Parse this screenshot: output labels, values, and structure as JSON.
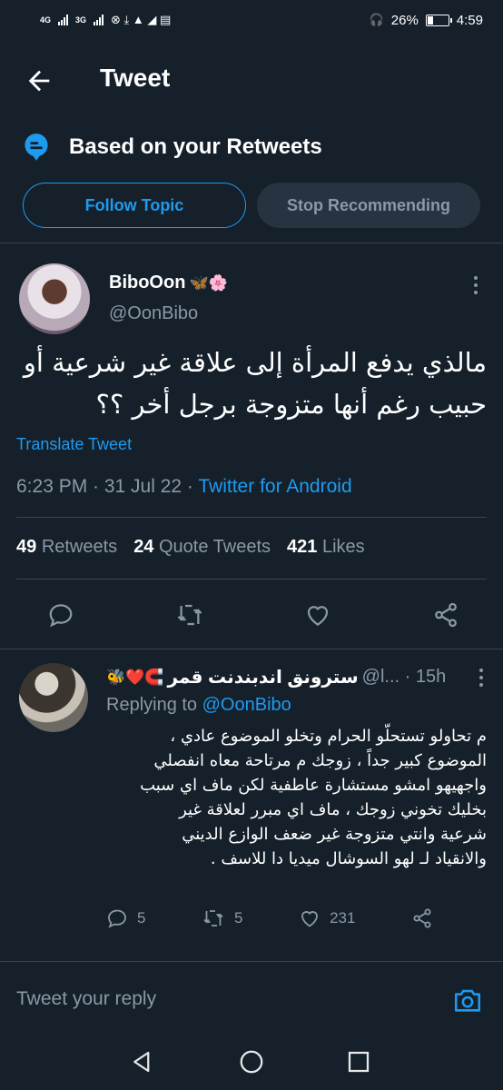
{
  "status_bar": {
    "network_1": "4G",
    "network_2": "3G",
    "battery": "26%",
    "time": "4:59"
  },
  "header": {
    "title": "Tweet"
  },
  "context": {
    "title": "Based on your Retweets",
    "follow_label": "Follow Topic",
    "stop_label": "Stop Recommending"
  },
  "tweet": {
    "author_name": "BiboOon",
    "author_emoji": "🦋🌸",
    "author_handle": "@OonBibo",
    "text_line1": "مالذي يدفع المرأة إلى علاقة غير شرعية أو",
    "text_line2": "حبيب رغم أنها متزوجة برجل أخر ؟؟",
    "translate_label": "Translate Tweet",
    "time": "6:23 PM · 31 Jul 22 · ",
    "source": "Twitter for Android",
    "retweets_count": "49",
    "retweets_label": "Retweets",
    "quotes_count": "24",
    "quotes_label": "Quote Tweets",
    "likes_count": "421",
    "likes_label": "Likes"
  },
  "reply": {
    "emoji": "🐝❤️🧲",
    "name": "سترونق اندبندنت قمر",
    "handle_time": "@l... · 15h",
    "replying_prefix": "Replying to ",
    "replying_handle": "@OonBibo",
    "lines": [
      "م تحاولو تستحلّو الحرام وتخلو الموضوع عادي ،",
      "الموضوع كبير جداً ، زوجك م مرتاحة معاه انفصلي",
      "واجهيهو امشو مستشارة عاطفية لكن ماف اي سبب",
      "بخليك تخوني زوجك ، ماف اي مبرر لعلاقة غير",
      "شرعية وانتي متزوجة غير ضعف الوازع الديني",
      "والانقياد لـ لهو السوشال ميديا دا للاسف ."
    ],
    "replies": "5",
    "retweets": "5",
    "likes": "231"
  },
  "reply_bar": {
    "placeholder": "Tweet your reply"
  },
  "colors": {
    "background": "#15202b",
    "accent": "#1d9bf0",
    "muted": "#8b98a5",
    "divider": "#38444d"
  },
  "icons": [
    "back-arrow-icon",
    "topic-icon",
    "more-icon",
    "reply-icon",
    "retweet-icon",
    "like-icon",
    "share-icon",
    "camera-icon",
    "nav-back-icon",
    "nav-home-icon",
    "nav-recents-icon"
  ]
}
